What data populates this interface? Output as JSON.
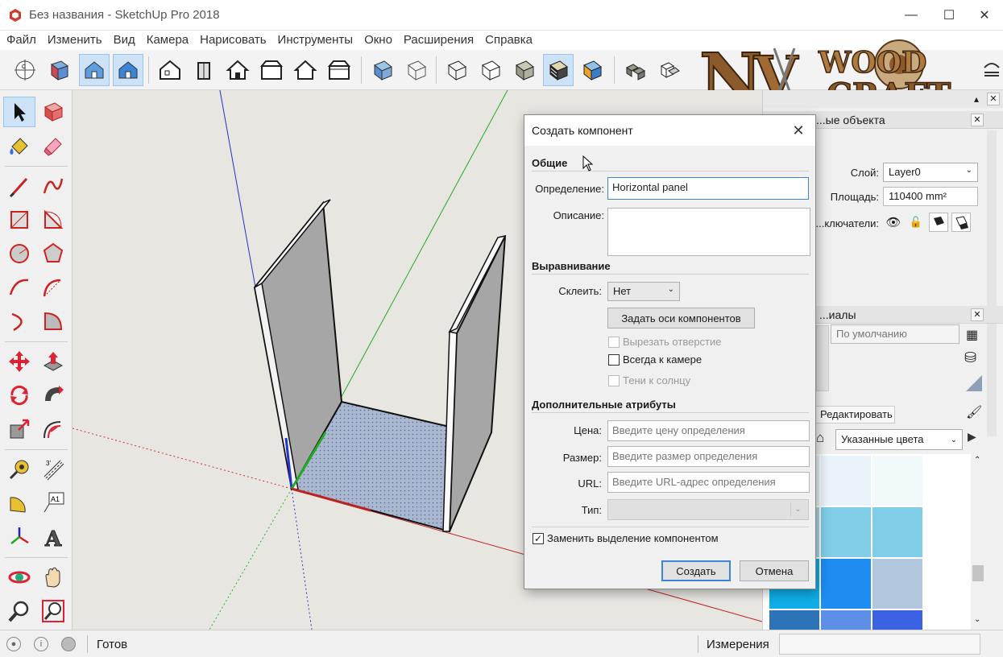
{
  "window": {
    "title": "Без названия - SketchUp Pro 2018"
  },
  "menu": [
    "Файл",
    "Изменить",
    "Вид",
    "Камера",
    "Нарисовать",
    "Инструменты",
    "Окно",
    "Расширения",
    "Справка"
  ],
  "logo": {
    "text_a": "NV",
    "text_b": "WOOD",
    "text_c": "CRAFT"
  },
  "entity_info": {
    "header": "...ые объекта",
    "layer_label": "Слой:",
    "layer_value": "Layer0",
    "area_label": "Площадь:",
    "area_value": "110400 mm²",
    "toggles_label": "...ключатели:"
  },
  "materials": {
    "header": "...иалы",
    "name_placeholder": "По умолчанию",
    "tab_edit": "Редактировать",
    "collection": "Указанные цвета",
    "swatch_colors": [
      "#e4f4f6",
      "#eaf3fa",
      "#f2f9fb",
      "#a9d9e3",
      "#7fcde7",
      "#0faee8",
      "#1e8cf1",
      "#b3c8df",
      "#2c73b7",
      "#5d8ee8",
      "#3c61e3",
      "#1aa9ea"
    ]
  },
  "status": {
    "text": "Готов",
    "measure_label": "Измерения"
  },
  "dialog": {
    "title": "Создать компонент",
    "general_section": "Общие",
    "definition_label": "Определение:",
    "definition_value": "Horizontal panel",
    "description_label": "Описание:",
    "alignment_section": "Выравнивание",
    "glue_label": "Склеить:",
    "glue_value": "Нет",
    "set_axes_button": "Задать оси компонентов",
    "cut_opening": "Вырезать отверстие",
    "always_face_camera": "Всегда к камере",
    "shadows_face_sun": "Тени к солнцу",
    "advanced_section": "Дополнительные атрибуты",
    "price_label": "Цена:",
    "price_placeholder": "Введите цену определения",
    "size_label": "Размер:",
    "size_placeholder": "Введите размер определения",
    "url_label": "URL:",
    "url_placeholder": "Введите URL-адрес определения",
    "type_label": "Тип:",
    "replace_selection": "Заменить выделение компонентом",
    "create_button": "Создать",
    "cancel_button": "Отмена"
  },
  "colors": {
    "accent": "#3b84d6",
    "panel_face": "#a6a6a6",
    "floor_face": "#a9b7d0"
  }
}
